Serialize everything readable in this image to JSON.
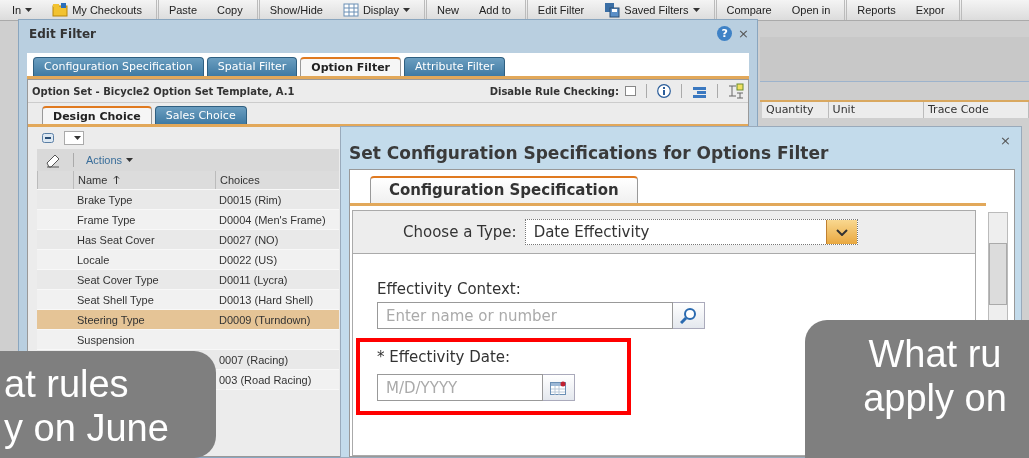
{
  "toolbar": {
    "groups": [
      [
        {
          "label": "In",
          "kind": "dropdown"
        },
        {
          "label": "My Checkouts",
          "kind": "icon"
        }
      ],
      [
        {
          "label": "Paste",
          "kind": "plain"
        },
        {
          "label": "Copy",
          "kind": "plain"
        }
      ],
      [
        {
          "label": "Show/Hide",
          "kind": "plain"
        },
        {
          "label": "Display",
          "kind": "icon-dropdown"
        }
      ],
      [
        {
          "label": "New",
          "kind": "plain"
        },
        {
          "label": "Add to",
          "kind": "plain"
        }
      ],
      [
        {
          "label": "Edit Filter",
          "kind": "plain"
        },
        {
          "label": "Saved Filters",
          "kind": "icon-dropdown"
        }
      ],
      [
        {
          "label": "Compare",
          "kind": "plain"
        },
        {
          "label": "Open in",
          "kind": "plain"
        }
      ],
      [
        {
          "label": "Reports",
          "kind": "plain"
        },
        {
          "label": "Expor",
          "kind": "plain"
        }
      ]
    ]
  },
  "background_table": {
    "columns": [
      "Quantity",
      "Unit",
      "Trace Code"
    ]
  },
  "edit_filter": {
    "title": "Edit Filter",
    "help": "?",
    "close": "×",
    "tabs": [
      {
        "label": "Configuration Specification",
        "selected": false
      },
      {
        "label": "Spatial Filter",
        "selected": false
      },
      {
        "label": "Option Filter",
        "selected": true
      },
      {
        "label": "Attribute Filter",
        "selected": false
      }
    ],
    "option_set": "Option Set - Bicycle2 Option Set Template, A.1",
    "disable_rule_checking": {
      "label": "Disable Rule Checking:",
      "checked": false
    },
    "sub_tabs": [
      {
        "label": "Design Choice",
        "selected": true
      },
      {
        "label": "Sales Choice",
        "selected": false
      }
    ],
    "actions_label": "Actions",
    "table": {
      "columns": [
        "Name",
        "Choices"
      ],
      "rows": [
        {
          "name": "Brake Type",
          "choices": "D0015 (Rim)",
          "selected": false
        },
        {
          "name": "Frame Type",
          "choices": "D0004 (Men's Frame)",
          "selected": false
        },
        {
          "name": "Has Seat Cover",
          "choices": "D0027 (NO)",
          "selected": false
        },
        {
          "name": "Locale",
          "choices": "D0022 (US)",
          "selected": false
        },
        {
          "name": "Seat Cover Type",
          "choices": "D0011 (Lycra)",
          "selected": false
        },
        {
          "name": "Seat Shell Type",
          "choices": "D0013 (Hard Shell)",
          "selected": false
        },
        {
          "name": "Steering Type",
          "choices": "D0009 (Turndown)",
          "selected": true
        },
        {
          "name": "Suspension",
          "selected": false
        },
        {
          "choices": "0007 (Racing)",
          "selected": false
        },
        {
          "choices": "003 (Road Racing)",
          "selected": false
        }
      ]
    }
  },
  "config_dialog": {
    "title": "Set Configuration Specifications for Options Filter",
    "close": "×",
    "tab": "Configuration Specification",
    "type_label": "Choose a Type:",
    "type_value": "Date Effectivity",
    "context_label": "Effectivity Context:",
    "context_placeholder": "Enter name or number",
    "date_label": "* Effectivity Date:",
    "date_placeholder": "M/D/YYYY"
  },
  "callouts": [
    {
      "lines": [
        "at rules",
        "y on June"
      ]
    },
    {
      "lines": [
        "What ru",
        "apply on"
      ]
    }
  ]
}
